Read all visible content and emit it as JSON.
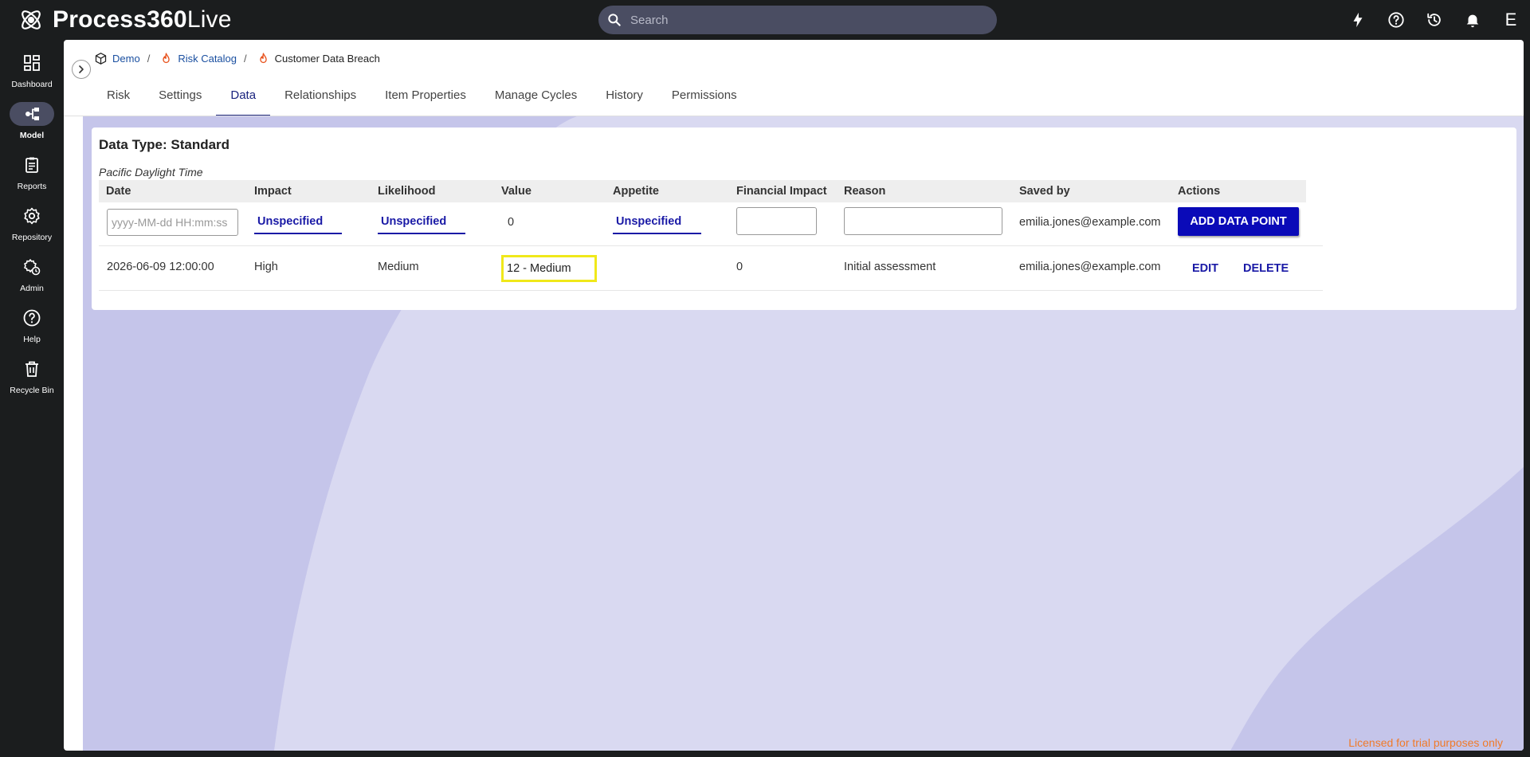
{
  "app": {
    "logo_bold": "Process360",
    "logo_light": "Live",
    "search_placeholder": "Search",
    "user_initial": "E"
  },
  "topbar_icons": [
    "lightning-icon",
    "help-icon",
    "history-icon",
    "bell-icon"
  ],
  "sidebar": {
    "items": [
      {
        "label": "Dashboard",
        "icon": "dashboard-icon",
        "active": false
      },
      {
        "label": "Model",
        "icon": "model-icon",
        "active": true
      },
      {
        "label": "Reports",
        "icon": "reports-icon",
        "active": false
      },
      {
        "label": "Repository",
        "icon": "repository-icon",
        "active": false
      },
      {
        "label": "Admin",
        "icon": "admin-icon",
        "active": false
      },
      {
        "label": "Help",
        "icon": "help-icon",
        "active": false
      },
      {
        "label": "Recycle Bin",
        "icon": "recycle-bin-icon",
        "active": false
      }
    ]
  },
  "breadcrumb": {
    "items": [
      {
        "label": "Demo",
        "icon": "cube-icon"
      },
      {
        "label": "Risk Catalog",
        "icon": "flame-icon"
      },
      {
        "label": "Customer Data Breach",
        "icon": "flame-icon"
      }
    ],
    "separator": "/"
  },
  "tabs": [
    {
      "label": "Risk",
      "active": false
    },
    {
      "label": "Settings",
      "active": false
    },
    {
      "label": "Data",
      "active": true
    },
    {
      "label": "Relationships",
      "active": false
    },
    {
      "label": "Item Properties",
      "active": false
    },
    {
      "label": "Manage Cycles",
      "active": false
    },
    {
      "label": "History",
      "active": false
    },
    {
      "label": "Permissions",
      "active": false
    }
  ],
  "card": {
    "title": "Data Type: Standard",
    "timezone": "Pacific Daylight Time",
    "columns": [
      "Date",
      "Impact",
      "Likelihood",
      "Value",
      "Appetite",
      "Financial Impact",
      "Reason",
      "Saved by",
      "Actions"
    ],
    "input_row": {
      "date_placeholder": "yyyy-MM-dd HH:mm:ss",
      "impact": "Unspecified",
      "likelihood": "Unspecified",
      "value": "0",
      "appetite": "Unspecified",
      "saved_by": "emilia.jones@example.com",
      "add_button": "ADD DATA POINT"
    },
    "data_rows": [
      {
        "date": "2026-06-09 12:00:00",
        "impact": "High",
        "likelihood": "Medium",
        "value": "12 - Medium",
        "appetite": "",
        "financial_impact": "0",
        "reason": "Initial assessment",
        "saved_by": "emilia.jones@example.com",
        "edit_label": "EDIT",
        "delete_label": "DELETE"
      }
    ]
  },
  "footer": {
    "license": "Licensed for trial purposes only"
  },
  "colors": {
    "accent": "#1a1aa6",
    "button": "#0a0ab8",
    "background_wave": "#c5c5ea",
    "background_light": "#d9d9f1",
    "highlight": "#f0e81a",
    "license_text": "#f07a2a"
  }
}
